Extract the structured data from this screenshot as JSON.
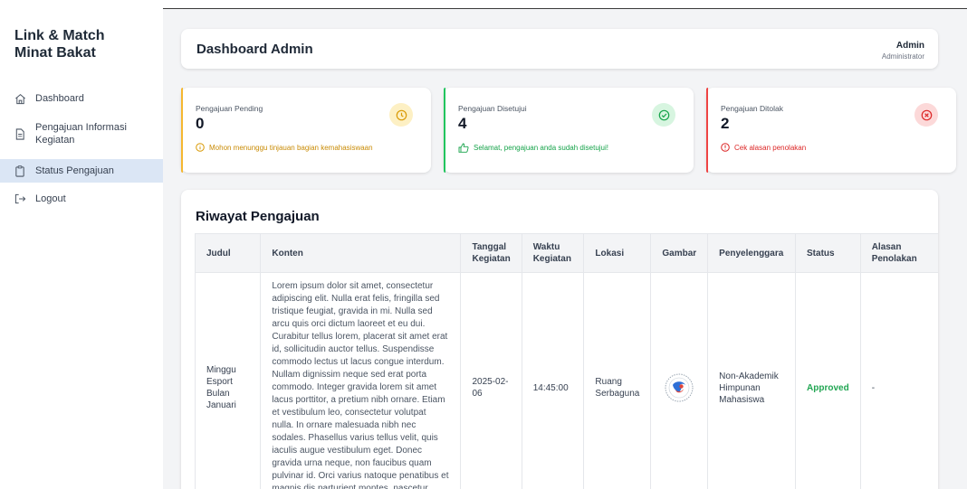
{
  "sidebar": {
    "brand_line1": "Link & Match",
    "brand_line2": "Minat Bakat",
    "items": [
      {
        "label": "Dashboard",
        "icon": "home-icon"
      },
      {
        "label_line1": "Pengajuan Informasi",
        "label_line2": "Kegiatan",
        "icon": "document-icon"
      },
      {
        "label": "Status Pengajuan",
        "icon": "clipboard-icon",
        "active": true
      },
      {
        "label": "Logout",
        "icon": "logout-icon"
      }
    ]
  },
  "header": {
    "title": "Dashboard Admin",
    "user_name": "Admin",
    "user_role": "Administrator"
  },
  "stats": [
    {
      "title": "Pengajuan Pending",
      "value": "0",
      "note": "Mohon menunggu tinjauan bagian kemahasiswaan",
      "color": "#f5b730",
      "icon": "clock-icon"
    },
    {
      "title": "Pengajuan Disetujui",
      "value": "4",
      "note": "Selamat, pengajuan anda sudah disetujui!",
      "color": "#22c55e",
      "icon": "check-circle-icon"
    },
    {
      "title": "Pengajuan Ditolak",
      "value": "2",
      "note": "Cek alasan penolakan",
      "color": "#ef4444",
      "icon": "x-circle-icon"
    }
  ],
  "table": {
    "title": "Riwayat Pengajuan",
    "headers": {
      "judul": "Judul",
      "konten": "Konten",
      "tanggal_1": "Tanggal",
      "tanggal_2": "Kegiatan",
      "waktu_1": "Waktu",
      "waktu_2": "Kegiatan",
      "lokasi": "Lokasi",
      "gambar": "Gambar",
      "penyelenggara": "Penyelenggara",
      "status": "Status",
      "alasan_1": "Alasan",
      "alasan_2": "Penolakan"
    },
    "rows": [
      {
        "judul_1": "Minggu",
        "judul_2": "Esport",
        "judul_3": "Bulan",
        "judul_4": "Januari",
        "konten": "Lorem ipsum dolor sit amet, consectetur adipiscing elit. Nulla erat felis, fringilla sed tristique feugiat, gravida in mi. Nulla sed arcu quis orci dictum laoreet et eu dui. Curabitur tellus lorem, placerat sit amet erat id, sollicitudin auctor tellus. Suspendisse commodo lectus ut lacus congue interdum. Nullam dignissim neque sed erat porta commodo. Integer gravida lorem sit amet lacus porttitor, a pretium nibh ornare. Etiam et vestibulum leo, consectetur volutpat nulla. In ornare malesuada nibh nec sodales. Phasellus varius tellus velit, quis iaculis augue vestibulum eget. Donec gravida urna neque, non faucibus quam pulvinar id. Orci varius natoque penatibus et magnis dis parturient montes, nascetur",
        "tanggal_1": "2025-02-",
        "tanggal_2": "06",
        "waktu": "14:45:00",
        "lokasi_1": "Ruang",
        "lokasi_2": "Serbaguna",
        "penyelenggara_1": "Non-Akademik",
        "penyelenggara_2": "Himpunan",
        "penyelenggara_3": "Mahasiswa",
        "status": "Approved",
        "alasan": "-"
      }
    ]
  }
}
